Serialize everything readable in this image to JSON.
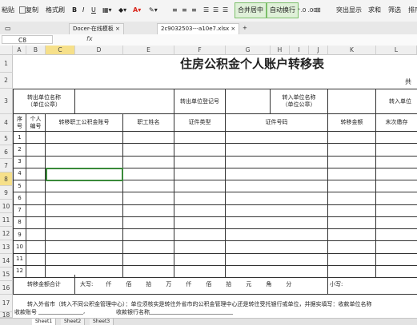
{
  "ribbon": {
    "paste": "粘贴",
    "copy": "复制",
    "format_painter": "格式刷",
    "merge_center": "合并居中",
    "auto_wrap": "自动换行",
    "highlight": "突出显示",
    "sum": "求和",
    "filter": "筛选",
    "sort": "排序"
  },
  "tabs": [
    {
      "label": "Docer-在线模板"
    },
    {
      "label": "2c9032503---a10e7.xlsx"
    }
  ],
  "formula_bar": {
    "cell_ref": "C8",
    "fx": "fx"
  },
  "columns": [
    "A",
    "B",
    "C",
    "D",
    "E",
    "F",
    "G",
    "H",
    "I",
    "J",
    "K",
    "L"
  ],
  "rows": [
    "1",
    "2",
    "3",
    "4",
    "5",
    "6",
    "7",
    "8",
    "9",
    "10",
    "11",
    "12",
    "13",
    "14",
    "15",
    "16",
    "17",
    "18"
  ],
  "form": {
    "title": "住房公积金个人账户转移表",
    "r2_right": "共",
    "out_unit": "转出单位名称\n（单位公章）",
    "out_reg": "转出单位登记号",
    "in_unit": "转入单位名称\n（单位公章）",
    "in_unit2": "转入单位",
    "h_seq": "序\n号",
    "h_personal": "个人\n编号",
    "h_account": "转移职工公积金账号",
    "h_name": "职工姓名",
    "h_idtype": "证件类型",
    "h_idno": "证件号码",
    "h_amount": "转移金额",
    "h_last": "末次缴存",
    "seq": [
      "1",
      "2",
      "3",
      "4",
      "5",
      "6",
      "7",
      "8",
      "9",
      "10",
      "11",
      "12"
    ],
    "total_label": "转移金额合计",
    "daxie": "大写:",
    "units": [
      "仟",
      "佰",
      "拾",
      "万",
      "仟",
      "佰",
      "拾",
      "元",
      "角",
      "分"
    ],
    "xiaoxie": "小写:",
    "note1": "转入外省市（转入不同公积金管理中心）：单位须核实是转往外省市的公积金管理中心还是转往受托银行或单位，并据实填写：收款单位名称",
    "note2": "收款账号",
    "note3": "收款银行名称"
  },
  "sheets": [
    "Sheet1",
    "Sheet2",
    "Sheet3"
  ]
}
